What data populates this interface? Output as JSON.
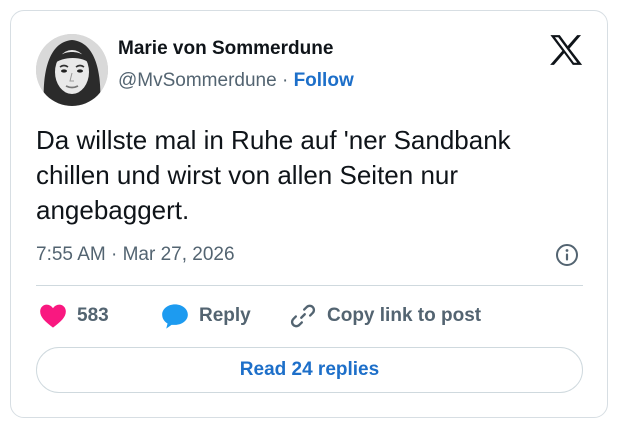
{
  "author": {
    "name": "Marie von Sommerdune",
    "handle": "@MvSommerdune",
    "separator": "·",
    "follow_label": "Follow"
  },
  "tweet": {
    "text": "Da willste mal in Ruhe auf 'ner Sandbank chillen und wirst von allen Seiten nur angebaggert.",
    "time": "7:55 AM",
    "date_separator": "·",
    "date": "Mar 27, 2026"
  },
  "actions": {
    "like_count": "583",
    "reply_label": "Reply",
    "copy_label": "Copy link to post"
  },
  "read_replies_label": "Read 24 replies",
  "icons": {
    "logo": "x-logo-icon",
    "info": "info-icon",
    "like": "heart-icon",
    "reply": "speech-bubble-icon",
    "copy": "link-icon"
  },
  "colors": {
    "text": "#0f1419",
    "secondary": "#536471",
    "link": "#1d6fc9",
    "heart": "#f91880",
    "reply_bubble": "#1d9bf0",
    "border": "#cfd9de"
  }
}
